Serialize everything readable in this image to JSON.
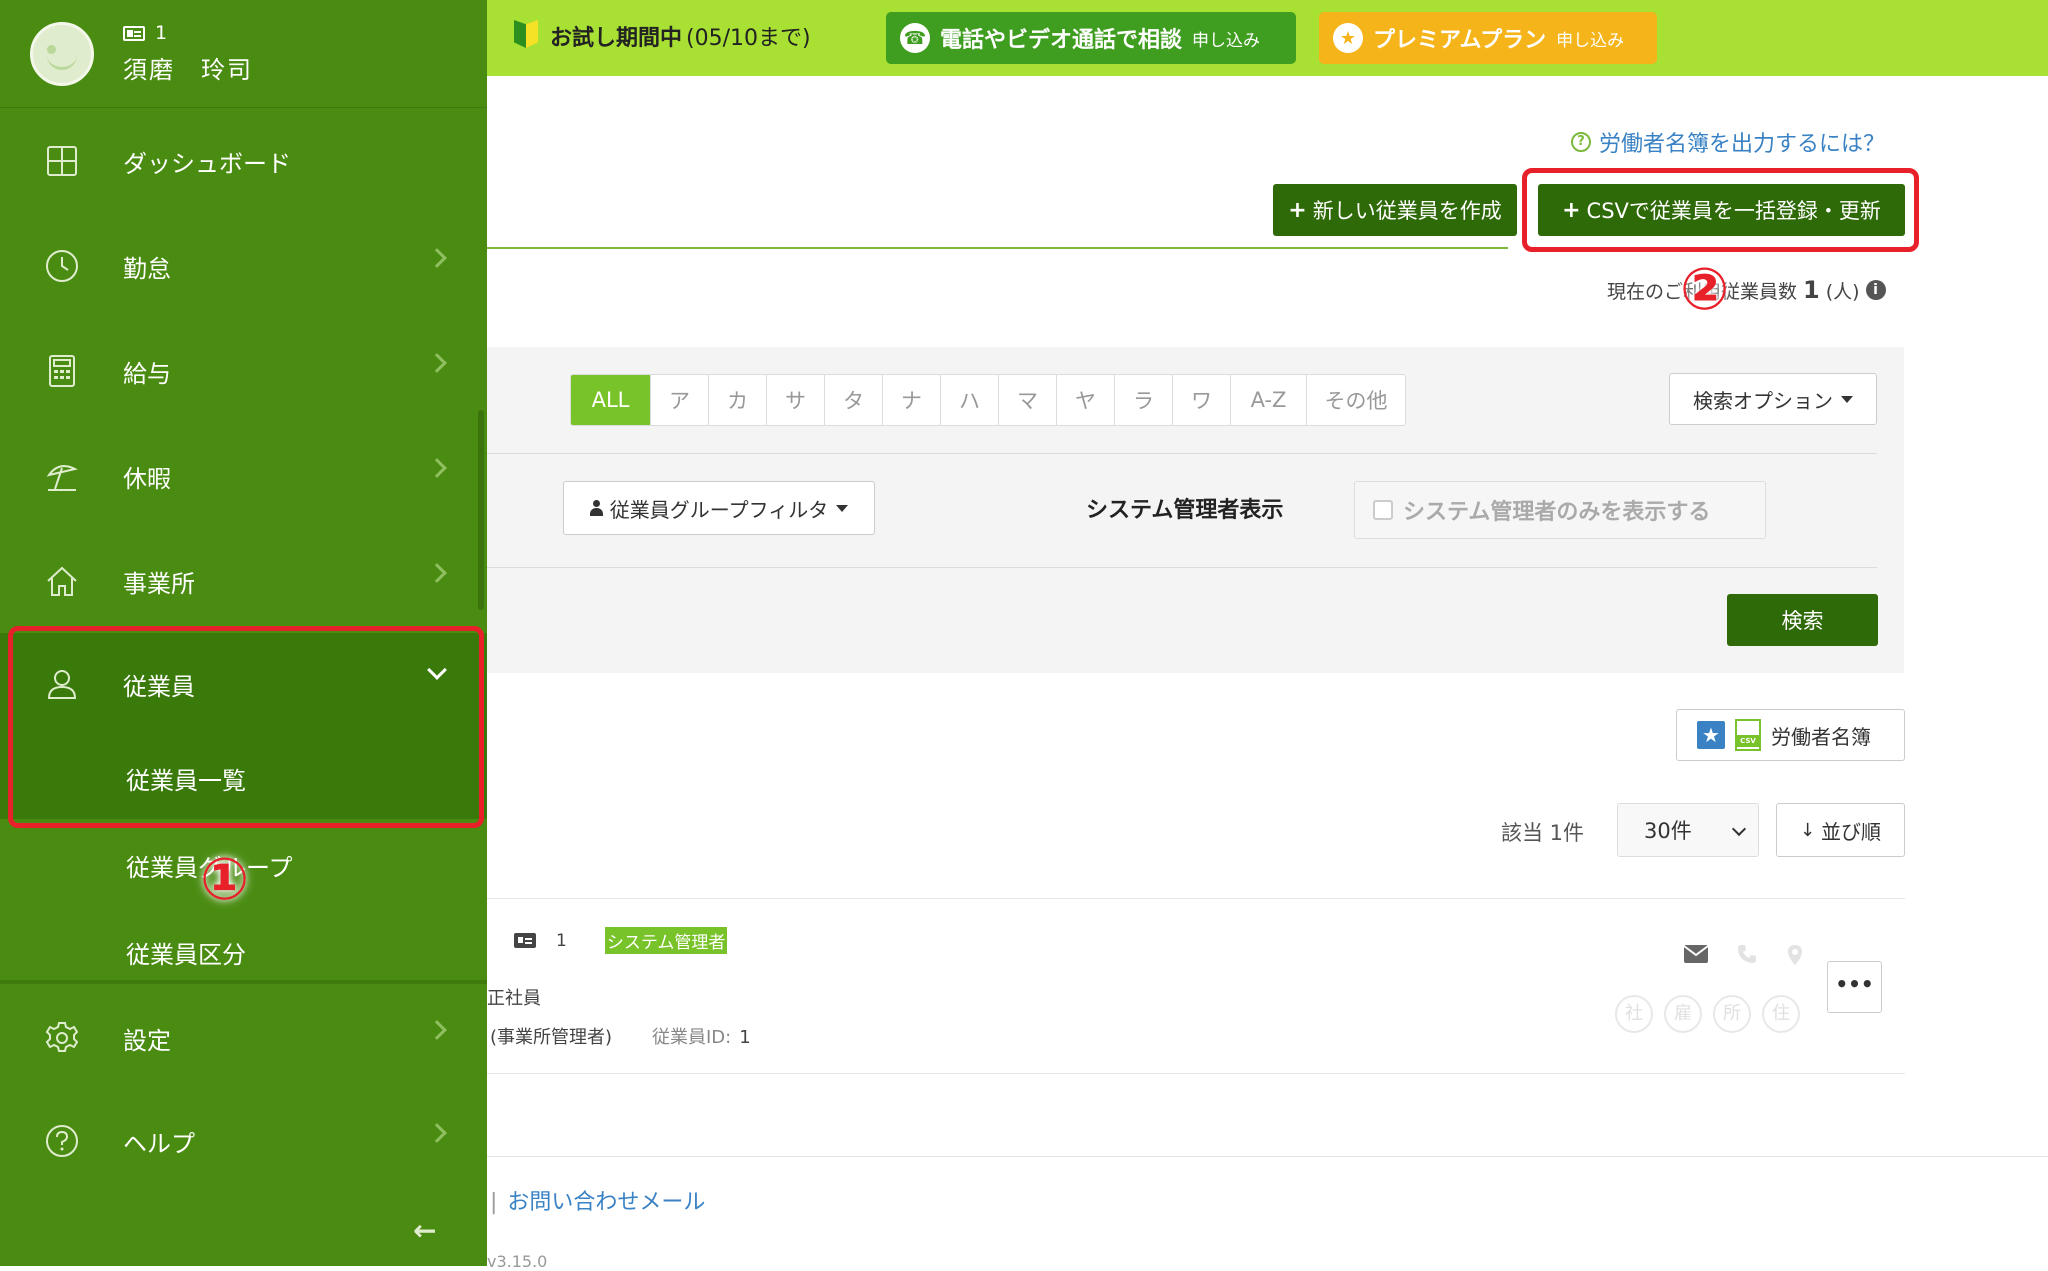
{
  "sidebar": {
    "profile": {
      "employee_id": "1",
      "name": "須磨　玲司"
    },
    "items": [
      {
        "label": "ダッシュボード",
        "icon": "dashboard-icon"
      },
      {
        "label": "勤怠",
        "icon": "clock-icon"
      },
      {
        "label": "給与",
        "icon": "calculator-icon"
      },
      {
        "label": "休暇",
        "icon": "beach-umbrella-icon"
      },
      {
        "label": "事業所",
        "icon": "home-icon"
      },
      {
        "label": "従業員",
        "icon": "user-icon"
      },
      {
        "label": "設定",
        "icon": "gear-icon"
      },
      {
        "label": "ヘルプ",
        "icon": "question-icon"
      }
    ],
    "sub_items": [
      "従業員一覧",
      "従業員グループ",
      "従業員区分"
    ],
    "collapse_icon": "arrow-left-icon"
  },
  "topbar": {
    "trial_label": "お試し期間中",
    "trial_period": "(05/10まで)",
    "consult": {
      "label": "電話やビデオ通話で相談",
      "action": "申し込み",
      "color": "#3f9d20"
    },
    "premium": {
      "label": "プレミアムプラン",
      "action": "申し込み",
      "color": "#f4b41a"
    },
    "bar_color": "#a8e034"
  },
  "main": {
    "help_link": "労働者名簿を出力するには？",
    "new_employee_button": "新しい従業員を作成",
    "csv_button": "CSVで従業員を一括登録・更新",
    "employee_count": {
      "prefix": "現在のご利用従業員数",
      "value": "1",
      "unit": "(人)"
    },
    "kana_filters": [
      "ALL",
      "ア",
      "カ",
      "サ",
      "タ",
      "ナ",
      "ハ",
      "マ",
      "ヤ",
      "ラ",
      "ワ",
      "A-Z",
      "その他"
    ],
    "search_options": "検索オプション",
    "group_filter": "従業員グループフィルタ",
    "sysadmin_label": "システム管理者表示",
    "sysadmin_checkbox": "システム管理者のみを表示する",
    "search_button": "検索",
    "roster_button": "労働者名簿",
    "hit_count": "該当 1件",
    "per_page": "30件",
    "sort_button": "並び順"
  },
  "employee": {
    "id": "1",
    "role": "システム管理者",
    "type": "正社員",
    "office": "(事業所管理者)",
    "id_label": "従業員ID:",
    "id_value": "1",
    "tags": [
      "社",
      "雇",
      "所",
      "住"
    ]
  },
  "footer": {
    "contact_link": "お問い合わせメール",
    "version": "v3.15.0"
  },
  "annotations": {
    "step1": "①",
    "step2": "②"
  },
  "colors": {
    "sidebar": "#4a8c12",
    "sidebar_active": "#3a7a0b",
    "dark_button": "#2f6a09",
    "accent_green": "#79c32a",
    "highlight": "#e8202a",
    "link": "#3a82c4"
  }
}
